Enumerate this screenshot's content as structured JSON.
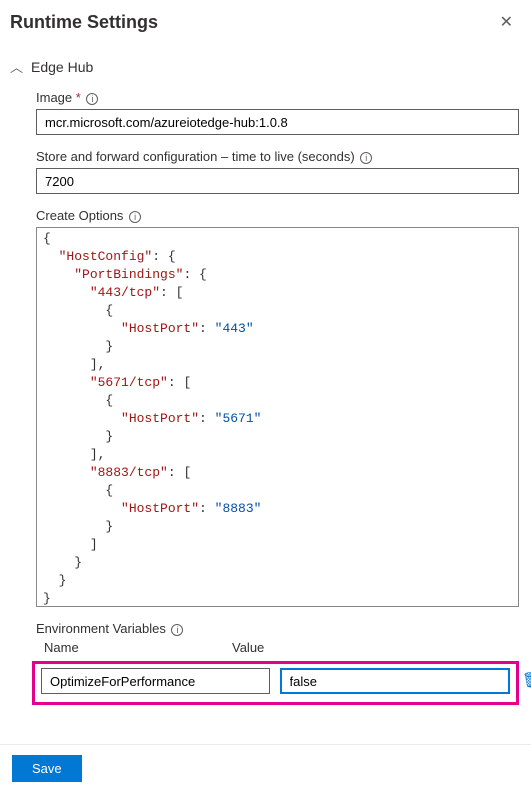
{
  "header": {
    "title": "Runtime Settings"
  },
  "section": {
    "title": "Edge Hub",
    "image_label": "Image",
    "image_value": "mcr.microsoft.com/azureiotedge-hub:1.0.8",
    "ttl_label": "Store and forward configuration – time to live (seconds)",
    "ttl_value": "7200",
    "create_options_label": "Create Options",
    "create_options_json": {
      "HostConfig": {
        "PortBindings": {
          "443/tcp": [
            {
              "HostPort": "443"
            }
          ],
          "5671/tcp": [
            {
              "HostPort": "5671"
            }
          ],
          "8883/tcp": [
            {
              "HostPort": "8883"
            }
          ]
        }
      }
    },
    "env_label": "Environment Variables",
    "env_columns": {
      "name": "Name",
      "value": "Value"
    },
    "env_rows": [
      {
        "name": "OptimizeForPerformance",
        "value": "false"
      }
    ]
  },
  "footer": {
    "save_label": "Save"
  }
}
